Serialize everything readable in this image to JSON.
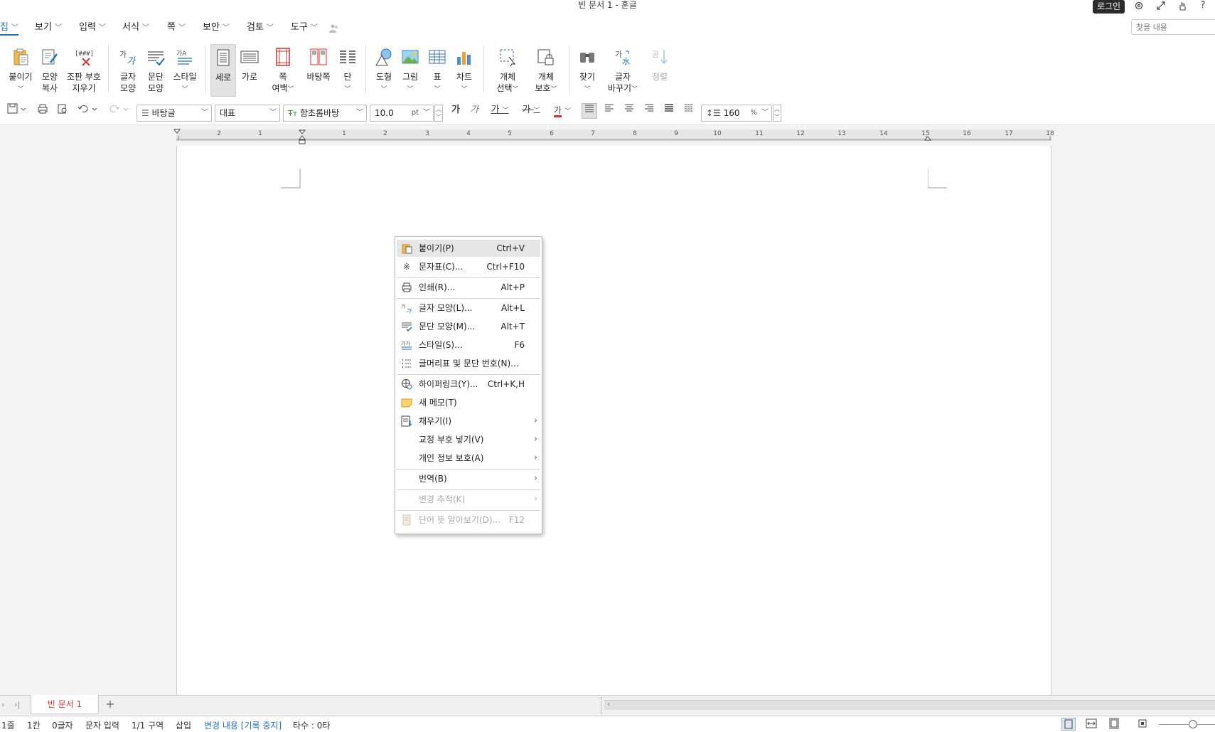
{
  "window": {
    "title": "빈 문서 1 - 훈글",
    "login_label": "로그인"
  },
  "menu": {
    "items": [
      "집",
      "보기",
      "입력",
      "서식",
      "쪽",
      "보안",
      "검토",
      "도구"
    ],
    "search_placeholder": "찾을 내용"
  },
  "ribbon": {
    "paste": "붙이기",
    "format_copy_1": "모양",
    "format_copy_2": "복사",
    "clear_1": "조판 부호",
    "clear_2": "지우기",
    "char_1": "글자",
    "char_2": "모양",
    "para_1": "문단",
    "para_2": "모양",
    "style": "스타일",
    "portrait": "세로",
    "landscape": "가로",
    "margin_1": "쪽",
    "margin_2": "여백",
    "master": "바탕쪽",
    "column": "단",
    "shape": "도형",
    "picture": "그림",
    "table": "표",
    "chart": "차트",
    "objsel_1": "개체",
    "objsel_2": "선택",
    "objprot_1": "개체",
    "objprot_2": "보호",
    "find": "찾기",
    "replace_1": "글자",
    "replace_2": "바꾸기",
    "sort": "정렬"
  },
  "toolbar": {
    "style_value": "바탕글",
    "lang_value": "대표",
    "font_value": "함초롬바탕",
    "size_value": "10.0",
    "size_unit": "pt",
    "spacing_value": "160",
    "spacing_unit": "%"
  },
  "ruler_numbers": [
    "2",
    "1",
    "1",
    "2",
    "3",
    "4",
    "5",
    "6",
    "7",
    "8",
    "9",
    "10",
    "11",
    "12",
    "13",
    "14",
    "15",
    "16",
    "17",
    "18"
  ],
  "context_menu": {
    "items": [
      {
        "label": "붙이기(P)",
        "shortcut": "Ctrl+V"
      },
      {
        "label": "문자표(C)...",
        "shortcut": "Ctrl+F10"
      },
      {
        "label": "인쇄(R)...",
        "shortcut": "Alt+P"
      },
      {
        "label": "글자 모양(L)...",
        "shortcut": "Alt+L"
      },
      {
        "label": "문단 모양(M)...",
        "shortcut": "Alt+T"
      },
      {
        "label": "스타일(S)...",
        "shortcut": "F6"
      },
      {
        "label": "글머리표 및 문단 번호(N)...",
        "shortcut": ""
      },
      {
        "label": "하이퍼링크(Y)...",
        "shortcut": "Ctrl+K,H"
      },
      {
        "label": "새 메모(T)",
        "shortcut": ""
      },
      {
        "label": "채우기(I)",
        "shortcut": ""
      },
      {
        "label": "교정 부호 넣기(V)",
        "shortcut": ""
      },
      {
        "label": "개인 정보 보호(A)",
        "shortcut": ""
      },
      {
        "label": "번역(B)",
        "shortcut": ""
      },
      {
        "label": "변경 추적(K)",
        "shortcut": ""
      },
      {
        "label": "단어 뜻 알아보기(D)...",
        "shortcut": "F12"
      }
    ]
  },
  "tabs": {
    "doc_tab": "빈 문서 1",
    "add": "+"
  },
  "status": {
    "line": "1줄",
    "col": "1칸",
    "chars": "0글자",
    "mode": "문자 입력",
    "section": "1/1 구역",
    "insert": "삽입",
    "track": "변경 내용 [기록 중지]",
    "typing": "타수 : 0타"
  }
}
